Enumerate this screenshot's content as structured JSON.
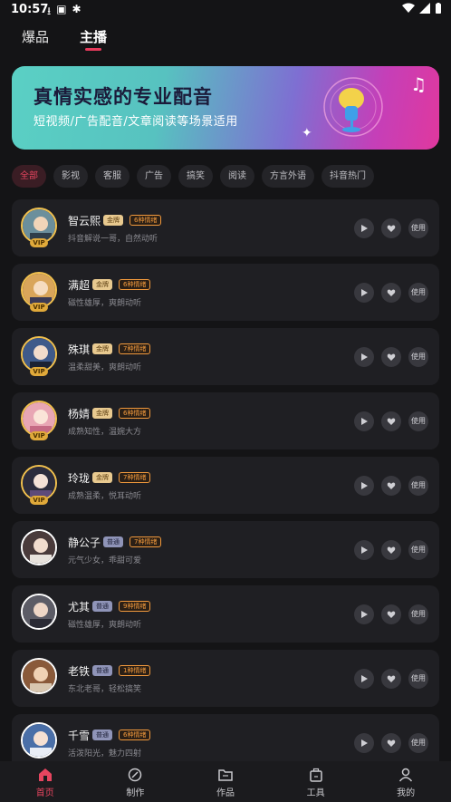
{
  "status_bar": {
    "time": "10:57"
  },
  "top_tabs": [
    {
      "label": "爆品",
      "active": false
    },
    {
      "label": "主播",
      "active": true
    }
  ],
  "banner": {
    "title": "真情实感的专业配音",
    "subtitle": "短视频/广告配音/文章阅读等场景适用"
  },
  "filters": [
    {
      "label": "全部",
      "active": true
    },
    {
      "label": "影视",
      "active": false
    },
    {
      "label": "客服",
      "active": false
    },
    {
      "label": "广告",
      "active": false
    },
    {
      "label": "搞笑",
      "active": false
    },
    {
      "label": "阅读",
      "active": false
    },
    {
      "label": "方言外语",
      "active": false
    },
    {
      "label": "抖音热门",
      "active": false
    }
  ],
  "anchors": [
    {
      "name": "智云熙",
      "tier": "金牌",
      "tier_type": "gold",
      "emotions": "6种情绪",
      "desc": "抖音解说一哥，自然动听",
      "vip": "VIP",
      "avatar_color": "#6b8f9c"
    },
    {
      "name": "满超",
      "tier": "金牌",
      "tier_type": "gold",
      "emotions": "6种情绪",
      "desc": "磁性雄厚，爽朗动听",
      "vip": "VIP",
      "avatar_color": "#d9a55a"
    },
    {
      "name": "殊琪",
      "tier": "金牌",
      "tier_type": "gold",
      "emotions": "7种情绪",
      "desc": "温柔甜美，爽朗动听",
      "vip": "VIP",
      "avatar_color": "#3f5a8a"
    },
    {
      "name": "杨婧",
      "tier": "金牌",
      "tier_type": "gold",
      "emotions": "6种情绪",
      "desc": "成熟知性，温婉大方",
      "vip": "VIP",
      "avatar_color": "#e8a6b4"
    },
    {
      "name": "玲珑",
      "tier": "金牌",
      "tier_type": "gold",
      "emotions": "7种情绪",
      "desc": "成熟温柔，悦耳动听",
      "vip": "VIP",
      "avatar_color": "#2c2c3c"
    },
    {
      "name": "静公子",
      "tier": "普通",
      "tier_type": "normal",
      "emotions": "7种情绪",
      "desc": "元气少女，乖甜可爱",
      "vip": "",
      "avatar_color": "#4a3b3b"
    },
    {
      "name": "尤其",
      "tier": "普通",
      "tier_type": "normal",
      "emotions": "9种情绪",
      "desc": "磁性雄厚，爽朗动听",
      "vip": "",
      "avatar_color": "#5c5c66"
    },
    {
      "name": "老铁",
      "tier": "普通",
      "tier_type": "normal",
      "emotions": "1种情绪",
      "desc": "东北老哥，轻松搞笑",
      "vip": "",
      "avatar_color": "#8a5a3a"
    },
    {
      "name": "千雪",
      "tier": "普通",
      "tier_type": "normal",
      "emotions": "6种情绪",
      "desc": "活泼阳光，魅力四射",
      "vip": "",
      "avatar_color": "#4a6fa8"
    }
  ],
  "action_labels": {
    "use": "使用"
  },
  "bottom_nav": [
    {
      "label": "首页",
      "icon": "home-icon",
      "active": true
    },
    {
      "label": "制作",
      "icon": "create-icon",
      "active": false
    },
    {
      "label": "作品",
      "icon": "folder-icon",
      "active": false
    },
    {
      "label": "工具",
      "icon": "toolbox-icon",
      "active": false
    },
    {
      "label": "我的",
      "icon": "user-icon",
      "active": false
    }
  ],
  "colors": {
    "accent": "#e6455f",
    "background": "#141416",
    "card": "#1f1f23",
    "gold_badge": "#e8c98f",
    "emotion_badge": "#f29a3d"
  }
}
